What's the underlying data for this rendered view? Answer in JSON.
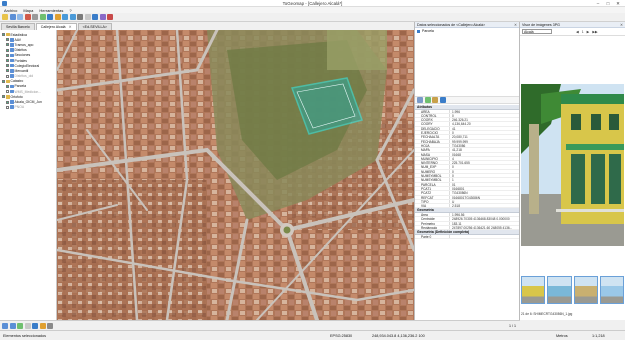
{
  "window": {
    "title": "ToGeomap - [Callejero Alcalá*]",
    "controls": [
      "–",
      "□",
      "✕"
    ]
  },
  "menu": [
    "Archivo",
    "Mapa",
    "Herramientas",
    "?"
  ],
  "tabs": [
    {
      "label": "Sevilla Barcelo",
      "active": false
    },
    {
      "label": "Callejero Alcalá",
      "active": true
    },
    {
      "label": "<Ed-SEVILLA>",
      "active": false
    }
  ],
  "layers": [
    {
      "label": "Estadistica",
      "level": 0,
      "checked": true
    },
    {
      "label": "AAV",
      "level": 1,
      "checked": true
    },
    {
      "label": "Tramos_apo",
      "level": 1,
      "checked": true
    },
    {
      "label": "Distritos",
      "level": 1,
      "checked": true
    },
    {
      "label": "Secciones",
      "level": 1,
      "checked": true
    },
    {
      "label": "Portales",
      "level": 1,
      "checked": true
    },
    {
      "label": "ColegioElectoral",
      "level": 1,
      "checked": true
    },
    {
      "label": "Mercantil",
      "level": 1,
      "checked": true
    },
    {
      "label": "Distritos_old",
      "level": 1,
      "checked": false
    },
    {
      "label": "Catastro",
      "level": 0,
      "checked": true
    },
    {
      "label": "Parcela",
      "level": 1,
      "checked": true
    },
    {
      "label": "WMS_Medicion...",
      "level": 1,
      "checked": false
    },
    {
      "label": "Ortofoto",
      "level": 0,
      "checked": true
    },
    {
      "label": "Alcala_OICM_Jun",
      "level": 1,
      "checked": true
    },
    {
      "label": "PNOA",
      "level": 1,
      "checked": false
    }
  ],
  "center_panel": {
    "title": "Datos seleccionados de <Callejero Alcalá>",
    "selected_layer": "Parcela",
    "sections": [
      {
        "name": "Atributos",
        "rows": [
          {
            "k": "AREA",
            "v": "1.996"
          },
          {
            "k": "CONTROL",
            "v": "0"
          },
          {
            "k": "COORX",
            "v": "246,326.21"
          },
          {
            "k": "COORY",
            "v": "4,136,644.20"
          },
          {
            "k": "DELEGACIO",
            "v": "41"
          },
          {
            "k": "EJERCICIO",
            "v": "0"
          },
          {
            "k": "FECHAALTA",
            "v": "20,080,711"
          },
          {
            "k": "FECHABAJA",
            "v": "99,999,999"
          },
          {
            "k": "HOJA",
            "v": "TG43086"
          },
          {
            "k": "MAPA",
            "v": "41,218"
          },
          {
            "k": "MASA",
            "v": "01668"
          },
          {
            "k": "MUNICIPIO",
            "v": "4"
          },
          {
            "k": "NINTERNO",
            "v": "225,701,655"
          },
          {
            "k": "NUM_EXP",
            "v": "0"
          },
          {
            "k": "NUMERO",
            "v": "0"
          },
          {
            "k": "NUMSYMBOL",
            "v": "0"
          },
          {
            "k": "NUMSYMBOL",
            "v": "1"
          },
          {
            "k": "PARCELA",
            "v": "01"
          },
          {
            "k": "PCAT1",
            "v": "0166801"
          },
          {
            "k": "PCAT2",
            "v": "TG43086N"
          },
          {
            "k": "REFCAT",
            "v": "0166801TG43086N"
          },
          {
            "k": "TIPO",
            "v": "U"
          },
          {
            "k": "VIA",
            "v": "2,518"
          }
        ]
      },
      {
        "name": "Geometría",
        "rows": [
          {
            "k": "Área",
            "v": "1,996.56"
          },
          {
            "k": "Centroide",
            "v": "248926.70305 4136468.83048 0.000000"
          },
          {
            "k": "Perímetro",
            "v": "183.11"
          },
          {
            "k": "Rectángulo",
            "v": "247897.00256 4136421.60 248055 4136..."
          }
        ]
      },
      {
        "name": "Geometría (Definición completa)",
        "rows": [
          {
            "k": "Parte 0",
            "v": ""
          }
        ]
      }
    ]
  },
  "right_panel": {
    "title": "Visor de imágenes 3PG",
    "combo": "Alcalá",
    "nav": [
      "◀",
      "1",
      "▶",
      "▶▶"
    ],
    "image_info": "21 de 6: SHIMECRTG43086N_1.jpg",
    "thumb_count": 4
  },
  "bottom_toolbar": {
    "page_counter": "1 / 1"
  },
  "status": {
    "left": "Elementos seleccionados",
    "crs": "EPSG:25830",
    "coords": "248,934.043.8 4,136,236.2 100",
    "units": "Metros",
    "scale": "1:1,218"
  },
  "colors": {
    "accent": "#2f6fb5",
    "selection": "#2ff0f0",
    "panel_header": "#e1e6ee"
  }
}
